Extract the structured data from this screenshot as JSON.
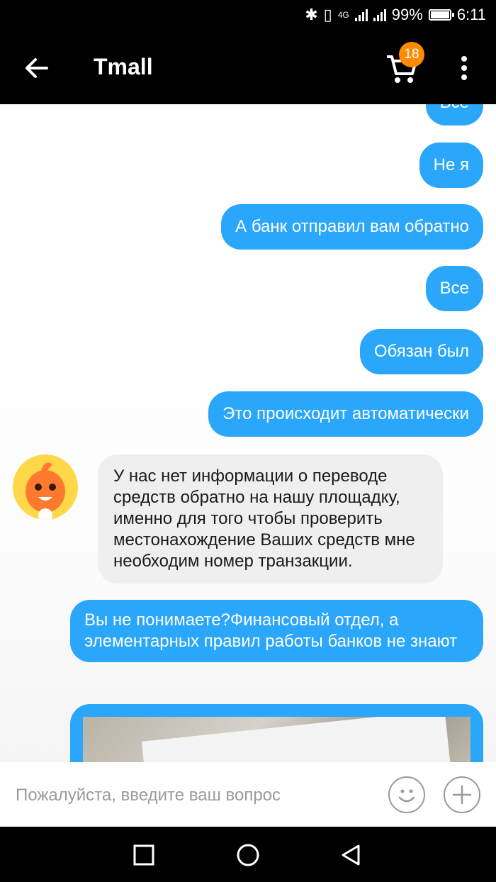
{
  "status": {
    "battery": "99%",
    "time": "6:11",
    "network": "4G"
  },
  "app": {
    "title": "Tmall",
    "cart_count": "18"
  },
  "messages": [
    {
      "text": "Все"
    },
    {
      "text": "Не я"
    },
    {
      "text": "А банк отправил вам обратно"
    },
    {
      "text": "Все"
    },
    {
      "text": "Обязан был"
    },
    {
      "text": "Это происходит автоматически"
    }
  ],
  "incoming": {
    "text": "У нас нет информации о переводе средств обратно на нашу площадку, именно для того чтобы проверить местонахождение Ваших средств мне необходим номер транзакции."
  },
  "outgoing_long": {
    "text": "Вы не понимаете?Финансовый отдел, а элементарных правил работы банков не знают"
  },
  "input": {
    "placeholder": "Пожалуйста, введите ваш вопрос",
    "value": ""
  },
  "icons": [
    "back-arrow-icon",
    "cart-icon",
    "more-vert-icon",
    "smile-icon",
    "plus-icon",
    "nav-square-icon",
    "nav-circle-icon",
    "nav-triangle-icon"
  ]
}
